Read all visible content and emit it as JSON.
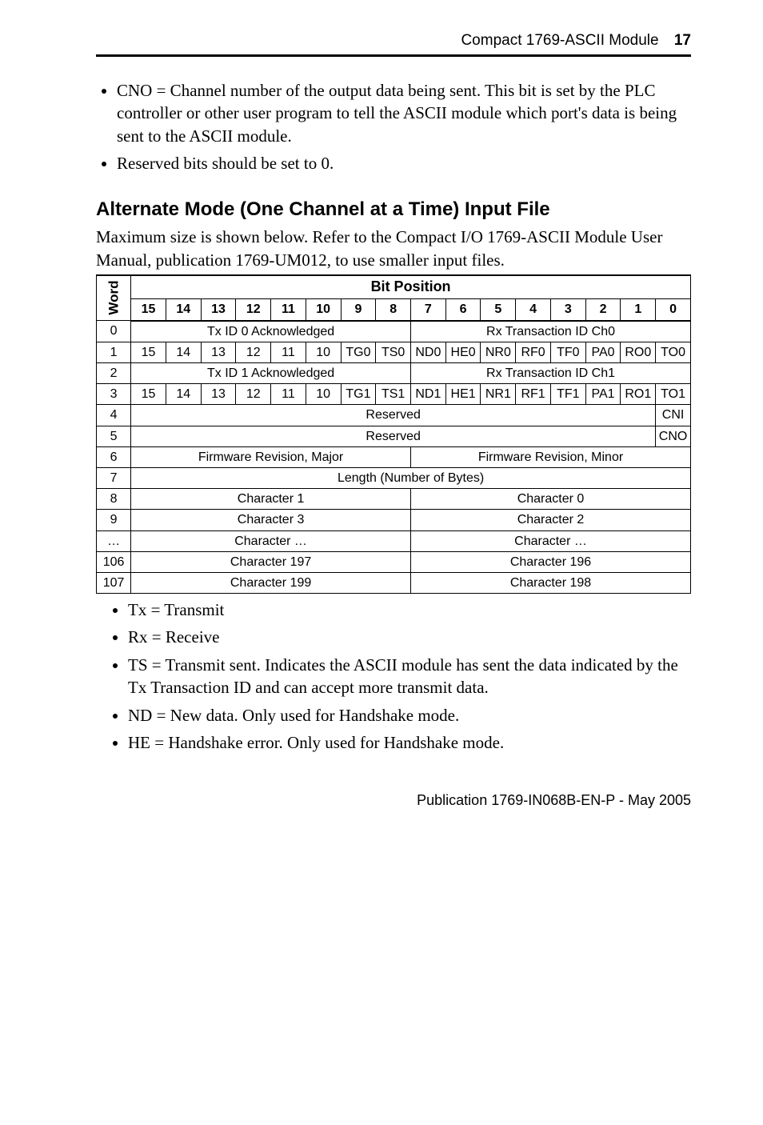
{
  "header": {
    "title": "Compact 1769-ASCII Module",
    "page_num": "17"
  },
  "top_bullets": [
    "CNO = Channel number of the output data being sent. This bit is set by the PLC controller or other user program to tell the ASCII module which port's data is being sent to the ASCII module.",
    "Reserved bits should be set to 0."
  ],
  "section_title": "Alternate Mode (One Channel at a Time) Input File",
  "intro": "Maximum size is shown below. Refer to the Compact I/O 1769-ASCII Module User Manual, publication 1769-UM012, to use smaller input files.",
  "table": {
    "word_label": "Word",
    "bit_position_label": "Bit Position",
    "bit_numbers": [
      "15",
      "14",
      "13",
      "12",
      "11",
      "10",
      "9",
      "8",
      "7",
      "6",
      "5",
      "4",
      "3",
      "2",
      "1",
      "0"
    ],
    "rows": [
      {
        "word": "0",
        "left": "Tx ID 0 Acknowledged",
        "right": "Rx Transaction ID Ch0"
      },
      {
        "word": "1",
        "cells": [
          "15",
          "14",
          "13",
          "12",
          "11",
          "10",
          "TG0",
          "TS0",
          "ND0",
          "HE0",
          "NR0",
          "RF0",
          "TF0",
          "PA0",
          "RO0",
          "TO0"
        ]
      },
      {
        "word": "2",
        "left": "Tx ID 1 Acknowledged",
        "right": "Rx Transaction ID Ch1"
      },
      {
        "word": "3",
        "cells": [
          "15",
          "14",
          "13",
          "12",
          "11",
          "10",
          "TG1",
          "TS1",
          "ND1",
          "HE1",
          "NR1",
          "RF1",
          "TF1",
          "PA1",
          "RO1",
          "TO1"
        ]
      },
      {
        "word": "4",
        "full": "Reserved",
        "last": "CNI"
      },
      {
        "word": "5",
        "full": "Reserved",
        "last": "CNO"
      },
      {
        "word": "6",
        "left": "Firmware Revision, Major",
        "right": "Firmware Revision, Minor"
      },
      {
        "word": "7",
        "fullspan": "Length (Number of Bytes)"
      },
      {
        "word": "8",
        "left": "Character 1",
        "right": "Character 0"
      },
      {
        "word": "9",
        "left": "Character 3",
        "right": "Character 2"
      },
      {
        "word": "…",
        "left": "Character …",
        "right": "Character …"
      },
      {
        "word": "106",
        "left": "Character 197",
        "right": "Character 196"
      },
      {
        "word": "107",
        "left": "Character 199",
        "right": "Character 198"
      }
    ]
  },
  "legend": [
    "Tx = Transmit",
    "Rx = Receive",
    "TS = Transmit sent. Indicates the ASCII module has sent the data indicated by the Tx Transaction ID and can accept more transmit data.",
    "ND = New data. Only used for Handshake mode.",
    "HE = Handshake error. Only used for Handshake mode."
  ],
  "footer": "Publication 1769-IN068B-EN-P - May 2005"
}
